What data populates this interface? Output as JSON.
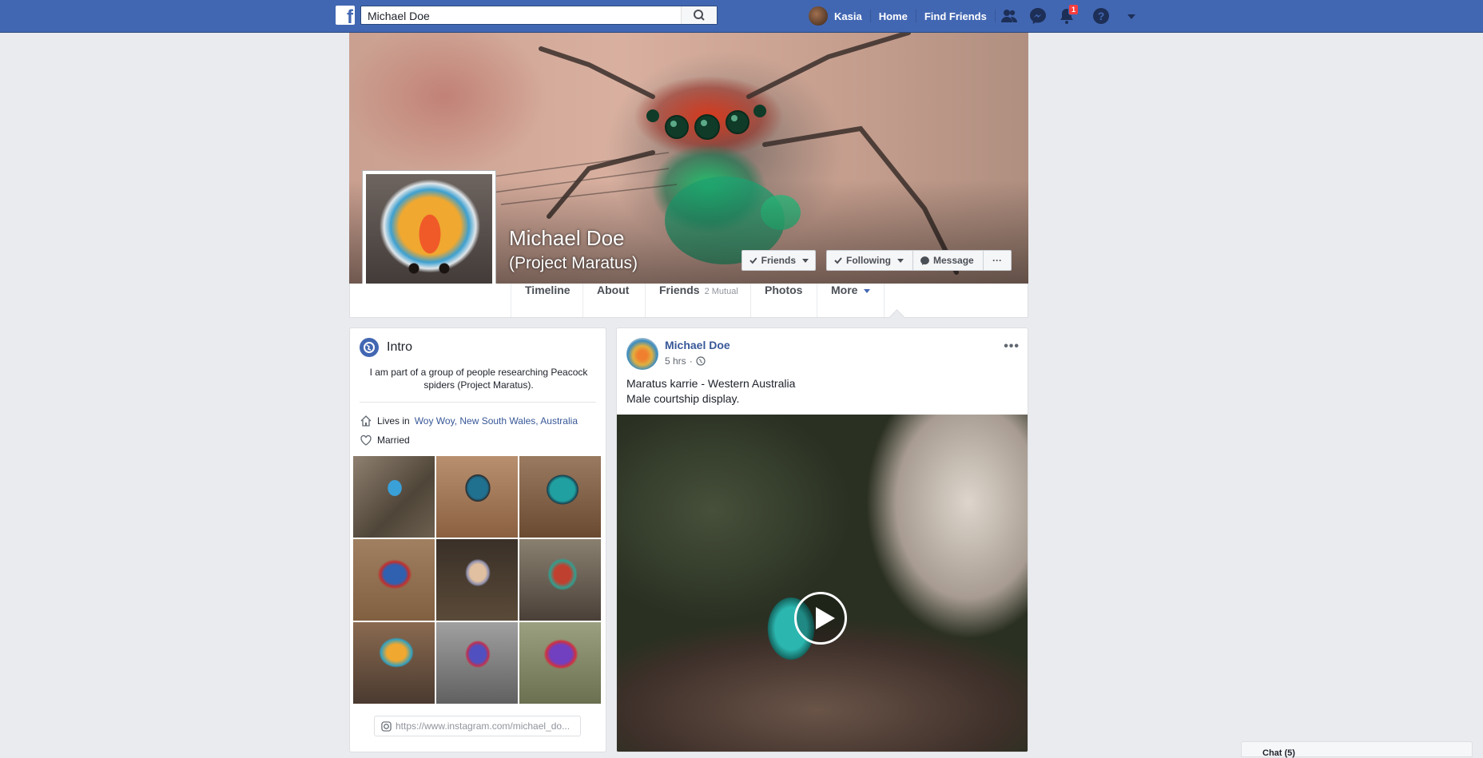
{
  "topbar": {
    "logo_letter": "f",
    "search_value": "Michael Doe",
    "user_name": "Kasia",
    "nav_links": [
      "Home",
      "Find Friends"
    ],
    "notification_count": "1",
    "icons": [
      "friends-icon",
      "messenger-icon",
      "notifications-icon",
      "help-icon",
      "account-menu-icon"
    ]
  },
  "cover": {
    "name": "Michael Doe",
    "subtitle": "(Project Maratus)",
    "buttons": {
      "friends": "Friends",
      "following": "Following",
      "message": "Message",
      "more": "···"
    }
  },
  "tabs": {
    "timeline": "Timeline",
    "about": "About",
    "friends": "Friends",
    "mutual": "2 Mutual",
    "photos": "Photos",
    "more": "More"
  },
  "intro": {
    "title": "Intro",
    "bio": "I am part of a group of people researching Peacock spiders (Project Maratus).",
    "lives_prefix": "Lives in",
    "lives_place": "Woy Woy, New South Wales, Australia",
    "relationship": "Married",
    "instagram": "https://www.instagram.com/michael_do..."
  },
  "post": {
    "author": "Michael Doe",
    "time": "5 hrs",
    "line1": "Maratus karrie - Western Australia",
    "line2": "Male courtship display.",
    "menu": "•••"
  },
  "chat": {
    "label": "Chat (5)"
  },
  "colors": {
    "brand_blue": "#4267b2",
    "link_blue": "#385898",
    "page_bg": "#e9ebee",
    "badge_red": "#fa3e3e"
  }
}
